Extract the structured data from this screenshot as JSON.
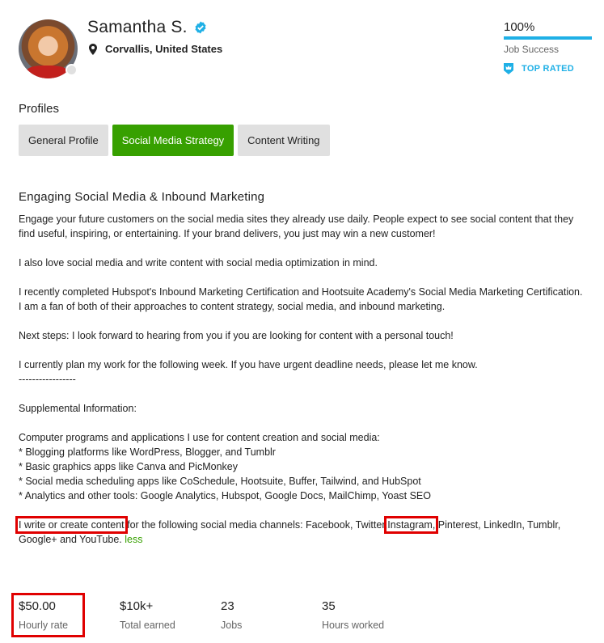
{
  "profile": {
    "name": "Samantha S.",
    "verified_icon": "verified-check-icon",
    "location_icon": "map-pin-icon",
    "location": "Corvallis, United States",
    "avatar_status": "offline"
  },
  "job_success": {
    "value": "100%",
    "progress_percent": 100,
    "label": "Job Success",
    "badge_icon": "top-rated-badge-icon",
    "badge_label": "TOP RATED",
    "accent_color": "#1fb0e6"
  },
  "profiles": {
    "title": "Profiles",
    "tabs": [
      {
        "label": "General Profile",
        "active": false
      },
      {
        "label": "Social Media Strategy",
        "active": true
      },
      {
        "label": "Content Writing",
        "active": false
      }
    ],
    "active_color": "#37a000"
  },
  "overview": {
    "title": "Engaging Social Media & Inbound Marketing",
    "paragraphs": [
      "Engage your future customers on the social media sites they already use daily. People expect to see social content that they find useful, inspiring, or entertaining. If your brand delivers, you just may win a new customer!",
      "I also love social media and write content with social media optimization in mind.",
      "I recently completed Hubspot's Inbound Marketing Certification and Hootsuite Academy's Social Media Marketing Certification. I am a fan of both of their approaches to content strategy, social media, and inbound marketing.",
      "Next steps: I look forward to hearing from you if you are looking for content with a personal touch!",
      "I currently plan my work for the following week. If you have urgent deadline needs, please let me know.\n-----------------",
      "Supplemental Information:",
      "Computer programs and applications I use for content creation and social media:\n* Blogging platforms like WordPress, Blogger, and Tumblr\n* Basic graphics apps like Canva and PicMonkey\n* Social media scheduling apps like CoSchedule, Hootsuite, Buffer, Tailwind, and HubSpot\n* Analytics and other tools: Google Analytics, Hubspot, Google Docs, MailChimp, Yoast SEO"
    ],
    "last_paragraph": {
      "part1": "I write or create content",
      "part2": " for the following social media channels: Facebook, Twitter,",
      "part3": "Instagram,",
      "part4": " Pinterest, LinkedIn, Tumblr, Google+ and YouTube. ",
      "less_link": "less"
    }
  },
  "stats": [
    {
      "value": "$50.00",
      "label": "Hourly rate"
    },
    {
      "value": "$10k+",
      "label": "Total earned"
    },
    {
      "value": "23",
      "label": "Jobs"
    },
    {
      "value": "35",
      "label": "Hours worked"
    }
  ]
}
